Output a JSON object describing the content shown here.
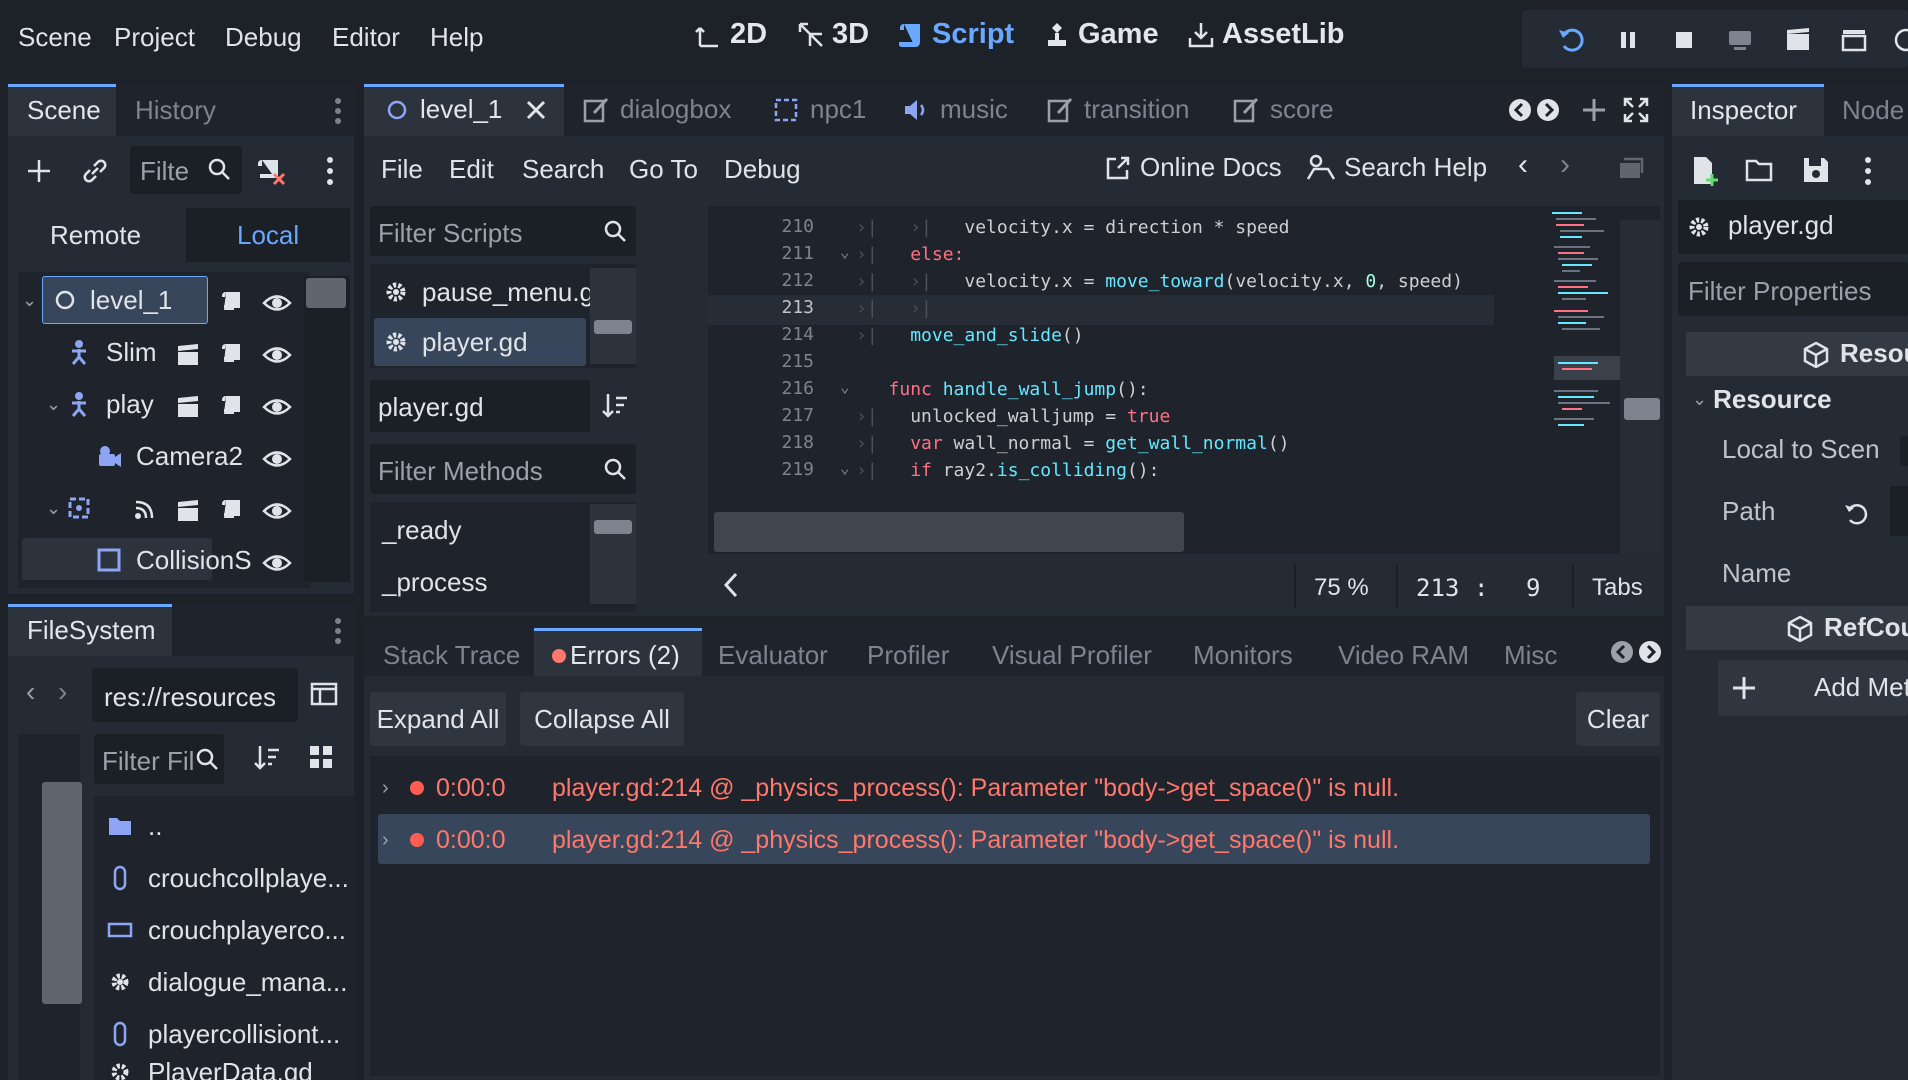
{
  "menu": [
    "Scene",
    "Project",
    "Debug",
    "Editor",
    "Help"
  ],
  "workspaces": [
    {
      "label": "2D",
      "icon": "2d-icon"
    },
    {
      "label": "3D",
      "icon": "3d-icon"
    },
    {
      "label": "Script",
      "icon": "script-icon",
      "active": true
    },
    {
      "label": "Game",
      "icon": "game-icon"
    },
    {
      "label": "AssetLib",
      "icon": "assetlib-icon"
    }
  ],
  "scene_dock": {
    "tabs": [
      "Scene",
      "History"
    ],
    "filter_placeholder": "Filte",
    "remote_label": "Remote",
    "local_label": "Local",
    "nodes": [
      "level_1",
      "Slim",
      "play",
      "Camera2",
      "",
      "CollisionS"
    ]
  },
  "filesystem": {
    "tab": "FileSystem",
    "path": "res://resources",
    "filter_placeholder": "Filter Fil",
    "files": [
      "..",
      "crouchcollplaye...",
      "crouchplayerco...",
      "dialogue_mana...",
      "playercollisiont...",
      "PlayerData.gd"
    ]
  },
  "script_tabs": [
    "level_1",
    "dialogbox",
    "npc1",
    "music",
    "transition",
    "score"
  ],
  "script_menu": [
    "File",
    "Edit",
    "Search",
    "Go To",
    "Debug"
  ],
  "online_docs": "Online Docs",
  "search_help": "Search Help",
  "filter_scripts_placeholder": "Filter Scripts",
  "scripts": [
    "pause_menu.gd",
    "player.gd"
  ],
  "current_script": "player.gd",
  "filter_methods_placeholder": "Filter Methods",
  "methods": [
    "_ready",
    "_process"
  ],
  "code": {
    "line_numbers": [
      "210",
      "211",
      "212",
      "213",
      "214",
      "215",
      "216",
      "217",
      "218",
      "219"
    ],
    "lines": [
      [
        "velocity.x = direction * speed"
      ],
      [
        "else:"
      ],
      [
        "velocity.x = ",
        "move_toward",
        "(velocity.x, ",
        "0",
        ", speed)"
      ],
      [
        ""
      ],
      [
        "move_and_slide",
        "()"
      ],
      [
        ""
      ],
      [
        "func",
        " ",
        "handle_wall_jump",
        "():"
      ],
      [
        "unlocked_walljump = ",
        "true"
      ],
      [
        "var",
        " wall_normal = ",
        "get_wall_normal",
        "()"
      ],
      [
        "if",
        " ray2.",
        "is_colliding",
        "():"
      ]
    ]
  },
  "status": {
    "zoom": "75 %",
    "line": "213",
    "sep": ":",
    "col": "9",
    "indent": "Tabs"
  },
  "bottom_tabs": [
    "Stack Trace",
    "Errors (2)",
    "Evaluator",
    "Profiler",
    "Visual Profiler",
    "Monitors",
    "Video RAM",
    "Misc"
  ],
  "errors_toolbar": {
    "expand": "Expand All",
    "collapse": "Collapse All",
    "clear": "Clear"
  },
  "errors": [
    {
      "time": "0:00:0",
      "message": "player.gd:214 @ _physics_process(): Parameter \"body->get_space()\" is null."
    },
    {
      "time": "0:00:0",
      "message": "player.gd:214 @ _physics_process(): Parameter \"body->get_space()\" is null."
    }
  ],
  "inspector": {
    "tabs": [
      "Inspector",
      "Node"
    ],
    "resource_name": "player.gd",
    "filter_placeholder": "Filter Properties",
    "section_resource": "Resou",
    "group_resource": "Resource",
    "props": [
      "Local to Scen",
      "Path",
      "Name"
    ],
    "section_refcounted": "RefCou",
    "add_meta": "Add Met"
  },
  "colors": {
    "accent": "#6aa8ff",
    "error": "#ff786b",
    "keyword": "#ff7085",
    "function": "#66e6ff"
  }
}
